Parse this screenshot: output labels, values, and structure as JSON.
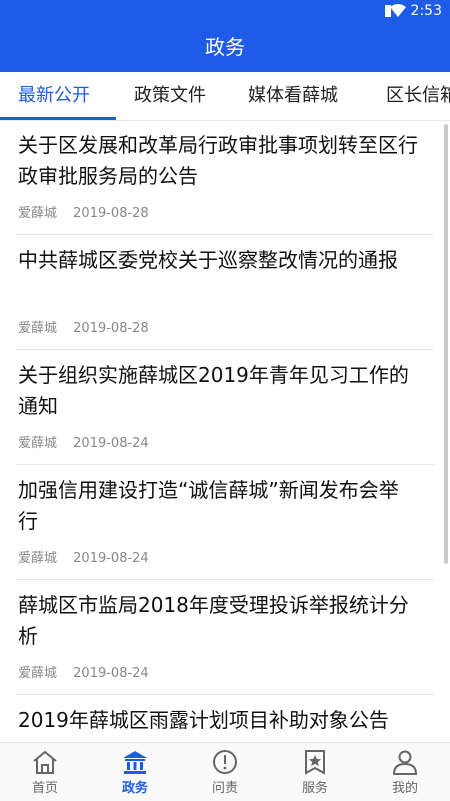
{
  "status": {
    "time": "2:53"
  },
  "header": {
    "title": "政务"
  },
  "tabs": [
    {
      "label": "最新公开",
      "active": true
    },
    {
      "label": "政策文件",
      "active": false
    },
    {
      "label": "媒体看薛城",
      "active": false
    },
    {
      "label": "区长信箱",
      "active": false
    }
  ],
  "articles": [
    {
      "title": "关于区发展和改革局行政审批事项划转至区行政审批服务局的公告",
      "source": "爱薛城",
      "date": "2019-08-28"
    },
    {
      "title": "中共薛城区委党校关于巡察整改情况的通报",
      "source": "爱薛城",
      "date": "2019-08-28"
    },
    {
      "title": "关于组织实施薛城区2019年青年见习工作的通知",
      "source": "爱薛城",
      "date": "2019-08-24"
    },
    {
      "title": "加强信用建设打造“诚信薛城”新闻发布会举行",
      "source": "爱薛城",
      "date": "2019-08-24"
    },
    {
      "title": "薛城区市监局2018年度受理投诉举报统计分析",
      "source": "爱薛城",
      "date": "2019-08-24"
    },
    {
      "title": "2019年薛城区雨露计划项目补助对象公告",
      "source": "",
      "date": ""
    }
  ],
  "nav": [
    {
      "label": "首页",
      "icon": "home-icon",
      "active": false
    },
    {
      "label": "政务",
      "icon": "government-building-icon",
      "active": true
    },
    {
      "label": "问责",
      "icon": "exclamation-circle-icon",
      "active": false
    },
    {
      "label": "服务",
      "icon": "star-bookmark-icon",
      "active": false
    },
    {
      "label": "我的",
      "icon": "user-icon",
      "active": false
    }
  ],
  "colors": {
    "primary": "#1e5be6",
    "text": "#111111",
    "meta": "#888888"
  }
}
